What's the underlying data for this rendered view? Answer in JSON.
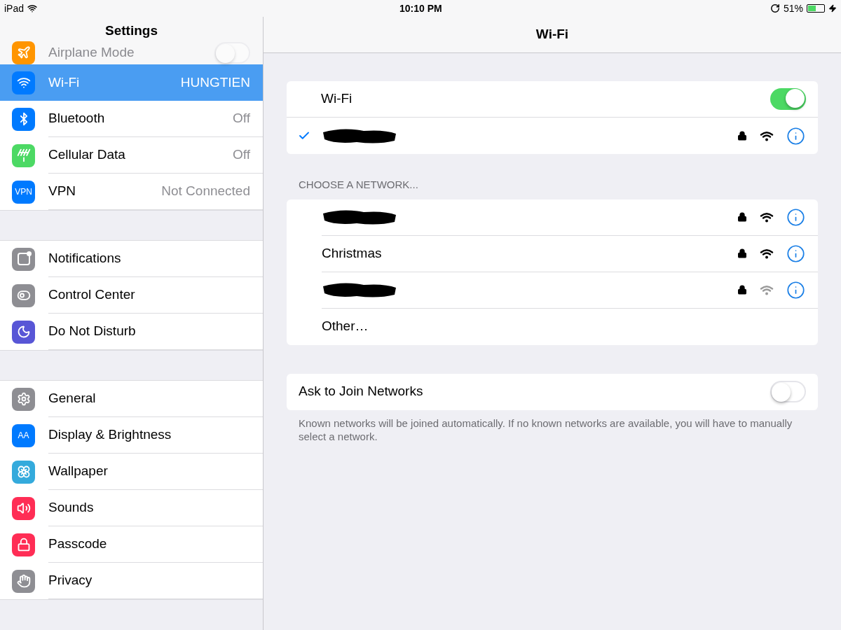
{
  "status_bar": {
    "device": "iPad",
    "time": "10:10 PM",
    "battery": "51%",
    "charging": true
  },
  "sidebar": {
    "title": "Settings",
    "sections": [
      {
        "items": [
          {
            "label": "Airplane Mode",
            "color": "#ff9500",
            "kind": "toggle",
            "on": false,
            "selected": false
          },
          {
            "label": "Wi-Fi",
            "value": "HUNGTIEN",
            "color": "#007aff",
            "kind": "value",
            "selected": true
          },
          {
            "label": "Bluetooth",
            "value": "Off",
            "color": "#007aff",
            "kind": "value",
            "selected": false
          },
          {
            "label": "Cellular Data",
            "value": "Off",
            "color": "#4cd964",
            "kind": "value",
            "selected": false
          },
          {
            "label": "VPN",
            "value": "Not Connected",
            "icon_label": "VPN",
            "color": "#007aff",
            "kind": "value",
            "selected": false
          }
        ]
      },
      {
        "items": [
          {
            "label": "Notifications",
            "color": "#8e8e93",
            "kind": "link",
            "selected": false
          },
          {
            "label": "Control Center",
            "color": "#8e8e93",
            "kind": "link",
            "selected": false
          },
          {
            "label": "Do Not Disturb",
            "color": "#5856d6",
            "kind": "link",
            "selected": false
          }
        ]
      },
      {
        "items": [
          {
            "label": "General",
            "color": "#8e8e93",
            "kind": "link",
            "selected": false
          },
          {
            "label": "Display & Brightness",
            "icon_label": "AA",
            "color": "#007aff",
            "kind": "link",
            "selected": false
          },
          {
            "label": "Wallpaper",
            "color": "#34aadc",
            "kind": "link",
            "selected": false
          },
          {
            "label": "Sounds",
            "color": "#ff2d55",
            "kind": "link",
            "selected": false
          },
          {
            "label": "Passcode",
            "color": "#ff2d55",
            "kind": "link",
            "selected": false
          },
          {
            "label": "Privacy",
            "color": "#8e8e93",
            "kind": "link",
            "selected": false
          }
        ]
      }
    ]
  },
  "detail": {
    "title": "Wi-Fi",
    "wifi": {
      "label": "Wi-Fi",
      "on": true
    },
    "connected": {
      "kind": "redacted",
      "locked": true,
      "weak_signal": false
    },
    "networks_header": "CHOOSE A NETWORK...",
    "networks": [
      {
        "kind": "redacted",
        "locked": true,
        "weak_signal": false
      },
      {
        "kind": "network",
        "name": "Christmas",
        "locked": true,
        "weak_signal": false
      },
      {
        "kind": "redacted",
        "locked": true,
        "weak_signal": true
      },
      {
        "kind": "other",
        "name": "Other…"
      }
    ],
    "ask_to_join": {
      "label": "Ask to Join Networks",
      "on": false
    },
    "footer": "Known networks will be joined automatically. If no known networks are available, you will have to manually select a network."
  }
}
